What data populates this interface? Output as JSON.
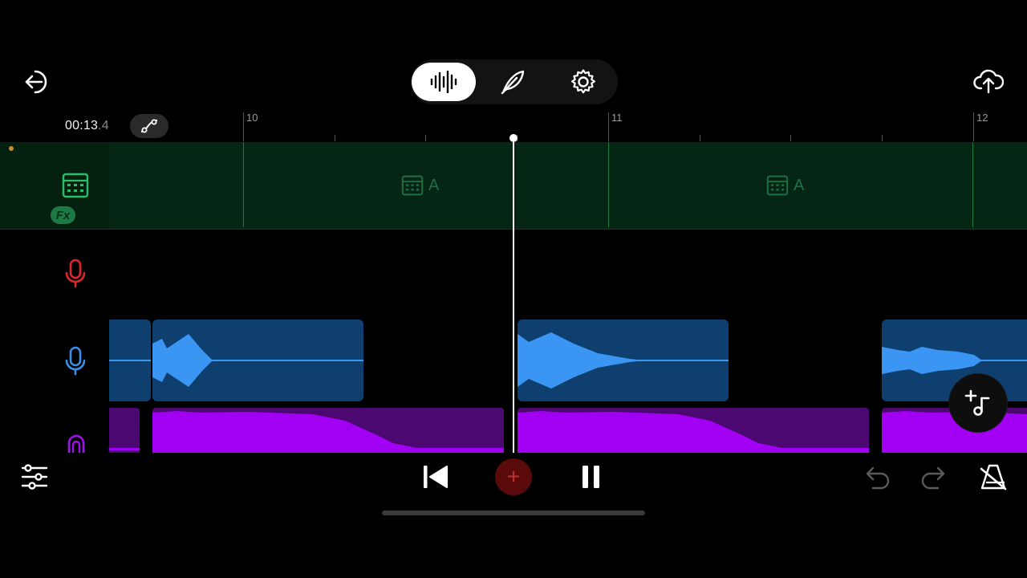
{
  "toolbar": {
    "back_icon": "exit-arrow-icon",
    "modes": [
      {
        "name": "waveform",
        "icon": "waveform-icon",
        "active": true
      },
      {
        "name": "feather",
        "icon": "feather-icon",
        "active": false
      },
      {
        "name": "settings",
        "icon": "gear-icon",
        "active": false
      }
    ],
    "upload_icon": "cloud-upload-icon"
  },
  "transport": {
    "time_main": "00:13",
    "time_fraction": ".4",
    "snap_icon": "curve-node-icon"
  },
  "ruler": {
    "labels": [
      "10",
      "11",
      "12"
    ]
  },
  "tracks": [
    {
      "type": "pattern",
      "icon": "drum-machine-icon",
      "badge": "Fx",
      "color": "#2bbd6a",
      "patterns": [
        {
          "label": "A"
        },
        {
          "label": "A"
        }
      ]
    },
    {
      "type": "voice",
      "icon": "microphone-icon",
      "color": "#e0262a"
    },
    {
      "type": "voice",
      "icon": "microphone-icon",
      "color": "#3a8fe6"
    },
    {
      "type": "synth",
      "icon": "synth-icon",
      "color": "#a010f0"
    }
  ],
  "bottom": {
    "mixer_icon": "sliders-icon",
    "rewind_icon": "skip-back-icon",
    "record_label": "+",
    "pause_icon": "pause-icon",
    "undo_icon": "undo-icon",
    "redo_icon": "redo-icon",
    "metronome_icon": "metronome-off-icon"
  },
  "fab": {
    "icon": "add-instrument-icon"
  },
  "colors": {
    "background": "#000000",
    "pattern_track": "#062615",
    "voice_clip": "#0f3f6e",
    "voice_wave": "#3a96f2",
    "synth_clip": "#4a0870",
    "synth_wave": "#a100f2"
  }
}
